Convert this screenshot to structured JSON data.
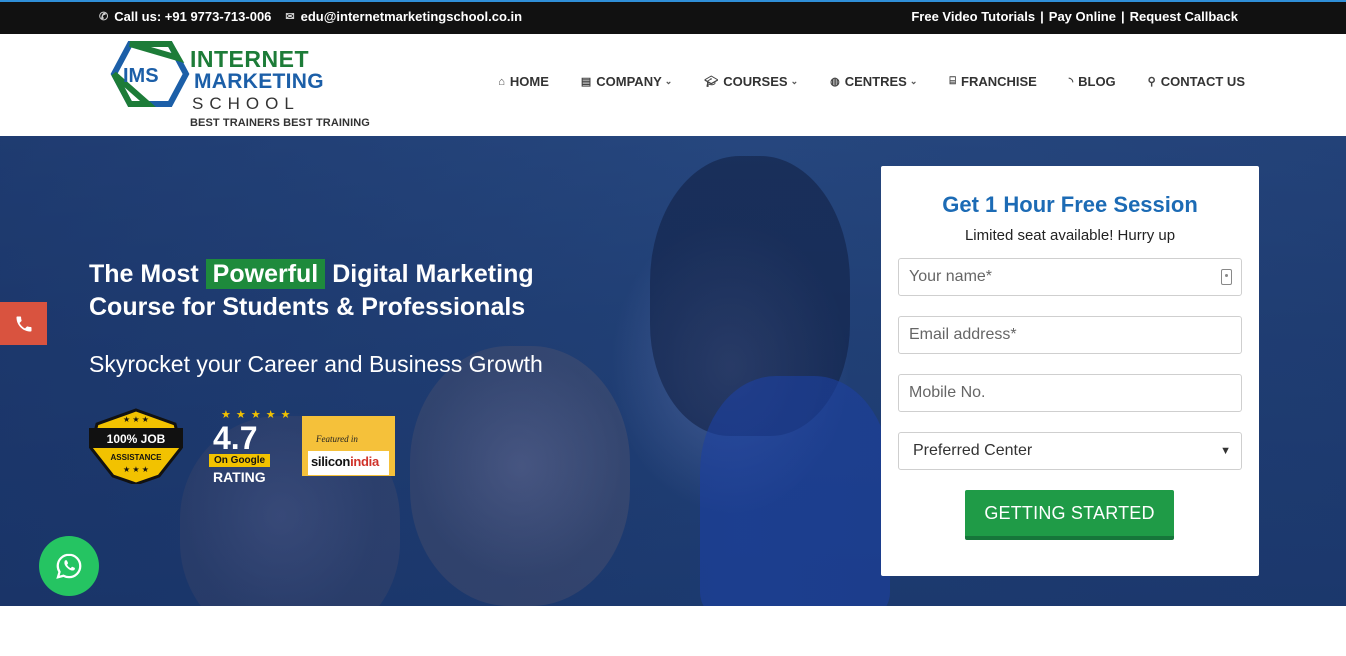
{
  "topbar": {
    "call": "Call us: +91 9773-713-006",
    "email": "edu@internetmarketingschool.co.in",
    "links": [
      "Free Video Tutorials",
      "Pay Online",
      "Request Callback"
    ],
    "separator": "|"
  },
  "logo": {
    "mark": "IMS",
    "line1": "INTERNET",
    "line2": "MARKETING",
    "line3": "SCHOOL",
    "tagline": "BEST TRAINERS BEST TRAINING"
  },
  "nav": {
    "items": [
      {
        "label": "HOME",
        "icon": "home-icon"
      },
      {
        "label": "COMPANY",
        "icon": "building-icon",
        "caret": "⌄"
      },
      {
        "label": "COURSES",
        "icon": "graduation-cap-icon",
        "caret": "⌄"
      },
      {
        "label": "CENTRES",
        "icon": "globe-icon",
        "caret": "⌄"
      },
      {
        "label": "FRANCHISE",
        "icon": "bank-icon"
      },
      {
        "label": "BLOG",
        "icon": "rss-icon"
      },
      {
        "label": "CONTACT US",
        "icon": "map-marker-icon"
      }
    ]
  },
  "hero": {
    "headline_pre": "The Most ",
    "headline_highlight": "Powerful",
    "headline_post": " Digital Marketing",
    "headline_line2": "Course for Students & Professionals",
    "subhead": "Skyrocket your Career and Business Growth",
    "badge_job": {
      "top": "100% JOB",
      "bottom": "ASSISTANCE"
    },
    "badge_rating": {
      "value": "4.7",
      "ribbon": "On Google",
      "label": "RATING",
      "stars": "★ ★ ★ ★ ★"
    },
    "badge_featured": {
      "featured": "Featured in",
      "name_a": "silicon",
      "name_b": "india"
    }
  },
  "form": {
    "title": "Get 1 Hour Free Session",
    "subtitle": "Limited seat available! Hurry up",
    "name_placeholder": "Your name*",
    "email_placeholder": "Email address*",
    "mobile_placeholder": "Mobile No.",
    "center_selected": "Preferred Center",
    "submit": "GETTING STARTED"
  },
  "colors": {
    "brand_green": "#1f9b47",
    "brand_blue": "#1c6bb5",
    "call_tab": "#d9533f",
    "whatsapp": "#25c462"
  }
}
